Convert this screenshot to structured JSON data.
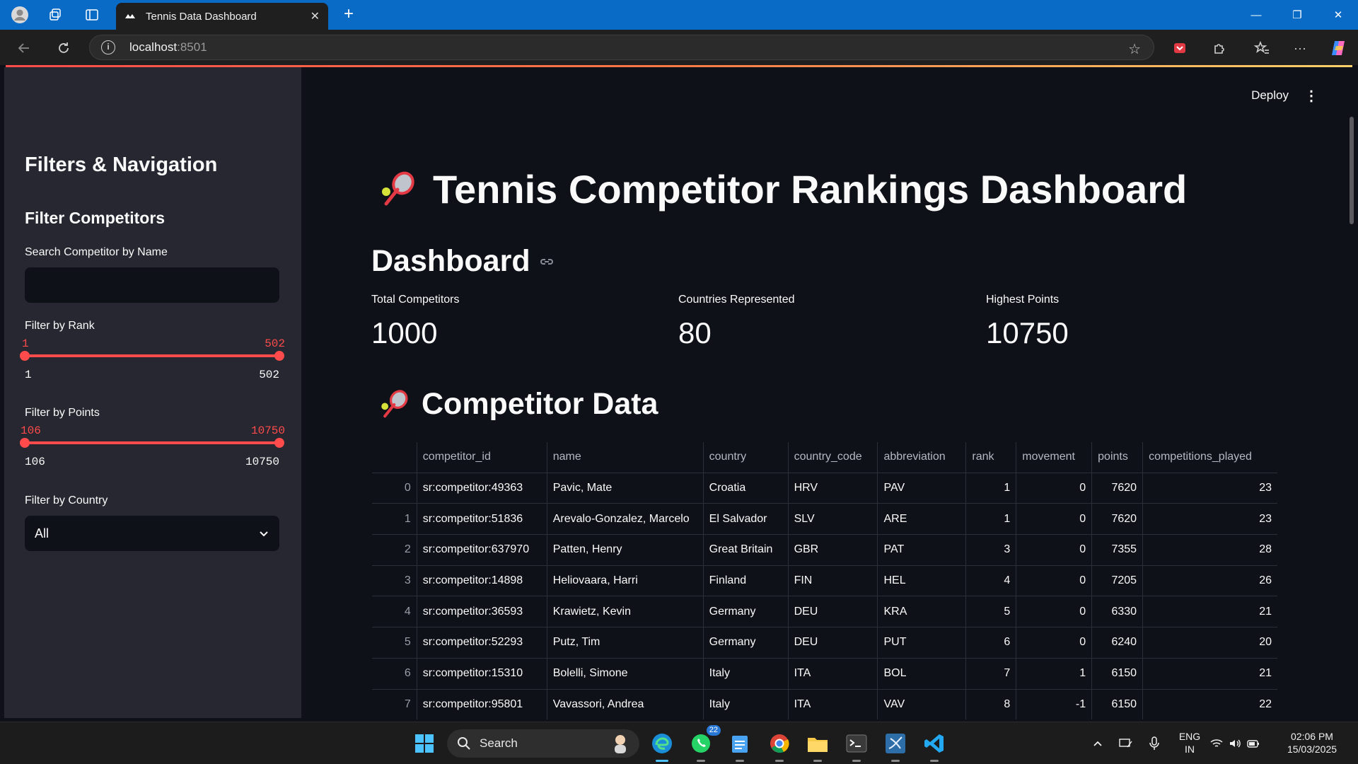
{
  "browser": {
    "tab_title": "Tennis Data Dashboard",
    "url_host": "localhost",
    "url_port": ":8501"
  },
  "sidebar": {
    "title": "Filters & Navigation",
    "subtitle": "Filter Competitors",
    "search_label": "Search Competitor by Name",
    "search_value": "",
    "rank_label": "Filter by Rank",
    "rank_selected_min": "1",
    "rank_selected_max": "502",
    "rank_range_min": "1",
    "rank_range_max": "502",
    "points_label": "Filter by Points",
    "points_selected_min": "106",
    "points_selected_max": "10750",
    "points_range_min": "106",
    "points_range_max": "10750",
    "country_label": "Filter by Country",
    "country_value": "All"
  },
  "header": {
    "deploy_label": "Deploy"
  },
  "main": {
    "title": "Tennis Competitor Rankings Dashboard",
    "section_dashboard": "Dashboard",
    "metrics": [
      {
        "label": "Total Competitors",
        "value": "1000"
      },
      {
        "label": "Countries Represented",
        "value": "80"
      },
      {
        "label": "Highest Points",
        "value": "10750"
      }
    ],
    "section_data": "Competitor Data"
  },
  "table": {
    "columns": [
      "",
      "competitor_id",
      "name",
      "country",
      "country_code",
      "abbreviation",
      "rank",
      "movement",
      "points",
      "competitions_played"
    ],
    "rows": [
      [
        "0",
        "sr:competitor:49363",
        "Pavic, Mate",
        "Croatia",
        "HRV",
        "PAV",
        "1",
        "0",
        "7620",
        "23"
      ],
      [
        "1",
        "sr:competitor:51836",
        "Arevalo-Gonzalez, Marcelo",
        "El Salvador",
        "SLV",
        "ARE",
        "1",
        "0",
        "7620",
        "23"
      ],
      [
        "2",
        "sr:competitor:637970",
        "Patten, Henry",
        "Great Britain",
        "GBR",
        "PAT",
        "3",
        "0",
        "7355",
        "28"
      ],
      [
        "3",
        "sr:competitor:14898",
        "Heliovaara, Harri",
        "Finland",
        "FIN",
        "HEL",
        "4",
        "0",
        "7205",
        "26"
      ],
      [
        "4",
        "sr:competitor:36593",
        "Krawietz, Kevin",
        "Germany",
        "DEU",
        "KRA",
        "5",
        "0",
        "6330",
        "21"
      ],
      [
        "5",
        "sr:competitor:52293",
        "Putz, Tim",
        "Germany",
        "DEU",
        "PUT",
        "6",
        "0",
        "6240",
        "20"
      ],
      [
        "6",
        "sr:competitor:15310",
        "Bolelli, Simone",
        "Italy",
        "ITA",
        "BOL",
        "7",
        "1",
        "6150",
        "21"
      ],
      [
        "7",
        "sr:competitor:95801",
        "Vavassori, Andrea",
        "Italy",
        "ITA",
        "VAV",
        "8",
        "-1",
        "6150",
        "22"
      ]
    ]
  },
  "taskbar": {
    "search_placeholder": "Search",
    "whatsapp_badge": "22",
    "lang_top": "ENG",
    "lang_bottom": "IN",
    "time": "02:06 PM",
    "date": "15/03/2025"
  },
  "colors": {
    "accent": "#ff4b4b",
    "app_bg": "#0e1117",
    "sidebar_bg": "#262730",
    "tabbar": "#0a6bc7"
  }
}
